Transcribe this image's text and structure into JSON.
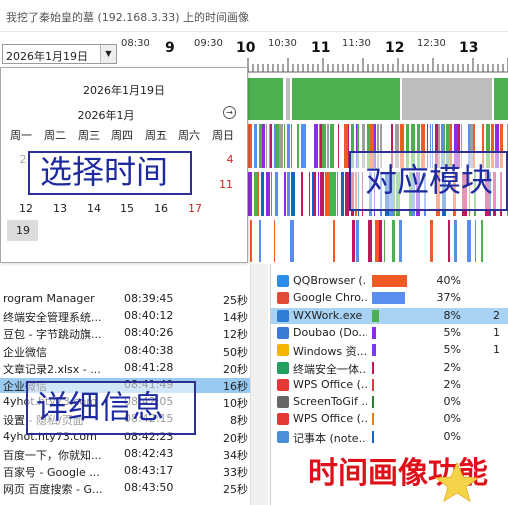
{
  "window": {
    "title": "我挖了秦始皇的墓 (192.168.3.33) 上的时间画像"
  },
  "date_picker": {
    "value": "2026年1月19日",
    "arrow": "▼"
  },
  "timeline": {
    "big_hours": [
      "9",
      "10",
      "11",
      "12",
      "13"
    ],
    "half_hours": [
      "08:30",
      "09:30",
      "10:30",
      "11:30",
      "12:30"
    ]
  },
  "calendar": {
    "today": "2026年1月19日",
    "month": "2026年1月",
    "next": "→",
    "weekdays": [
      "周一",
      "周二",
      "周三",
      "周四",
      "周五",
      "周六",
      "周日"
    ],
    "days_row1": [
      "2",
      "4"
    ],
    "days_row2": [
      "11"
    ],
    "days_row3": [
      "12",
      "13",
      "14",
      "15",
      "16",
      "17"
    ],
    "days_row4": [
      "19"
    ]
  },
  "detail_rows": [
    {
      "name": "rogram Manager",
      "time": "08:39:45",
      "dur": "25秒"
    },
    {
      "name": "终端安全管理系统...",
      "time": "08:40:12",
      "dur": "14秒"
    },
    {
      "name": "豆包 - 字节跳动旗...",
      "time": "08:40:26",
      "dur": "12秒"
    },
    {
      "name": "企业微信",
      "time": "08:40:38",
      "dur": "50秒"
    },
    {
      "name": "文章记录2.xlsx - ...",
      "time": "08:41:28",
      "dur": "20秒"
    },
    {
      "name": "企业微信",
      "time": "08:41:49",
      "dur": "16秒"
    },
    {
      "name": "4yhot.hty73.com",
      "time": "08:42:05",
      "dur": "10秒"
    },
    {
      "name": "设置 - 隐私/页面",
      "time": "08:42:15",
      "dur": "8秒"
    },
    {
      "name": "4yhot.hty73.com",
      "time": "08:42:23",
      "dur": "20秒"
    },
    {
      "name": "百度一下，你就知...",
      "time": "08:42:43",
      "dur": "34秒"
    },
    {
      "name": "百家号 - Google ...",
      "time": "08:43:17",
      "dur": "33秒"
    },
    {
      "name": "网页 百度搜索 - G...",
      "time": "08:43:50",
      "dur": "25秒"
    }
  ],
  "app_rows": [
    {
      "name": "QQBrowser (...",
      "percent": "40%",
      "extra": "",
      "share": 0.4,
      "color": "#f05a24",
      "icon": "qq-browser-icon",
      "icon_color": "#2a8ee8"
    },
    {
      "name": "Google Chro...",
      "percent": "37%",
      "extra": "",
      "share": 0.37,
      "color": "#5b8def",
      "icon": "chrome-icon",
      "icon_color": "#e04b36"
    },
    {
      "name": "WXWork.exe",
      "percent": "8%",
      "extra": "2",
      "share": 0.08,
      "color": "#4caf50",
      "icon": "wxwork-icon",
      "icon_color": "#2f7fd8"
    },
    {
      "name": "Doubao (Do...",
      "percent": "5%",
      "extra": "1",
      "share": 0.05,
      "color": "#8b2be2",
      "icon": "doubao-icon",
      "icon_color": "#3a7bd5"
    },
    {
      "name": "Windows 资...",
      "percent": "5%",
      "extra": "1",
      "share": 0.05,
      "color": "#7c3aed",
      "icon": "windows-explorer-icon",
      "icon_color": "#f4b400"
    },
    {
      "name": "终端安全一体...",
      "percent": "2%",
      "extra": "",
      "share": 0.02,
      "color": "#c2185b",
      "icon": "security-icon",
      "icon_color": "#20a060"
    },
    {
      "name": "WPS Office (...",
      "percent": "2%",
      "extra": "",
      "share": 0.02,
      "color": "#e53935",
      "icon": "wps-icon",
      "icon_color": "#e53935"
    },
    {
      "name": "ScreenToGif ...",
      "percent": "0%",
      "extra": "",
      "share": 0.004,
      "color": "#2e7d32",
      "icon": "screentogif-icon",
      "icon_color": "#666666"
    },
    {
      "name": "WPS Office (...",
      "percent": "0%",
      "extra": "",
      "share": 0.004,
      "color": "#f57c00",
      "icon": "wps-icon",
      "icon_color": "#e53935"
    },
    {
      "name": "记事本 (note...",
      "percent": "0%",
      "extra": "",
      "share": 0.003,
      "color": "#1565c0",
      "icon": "notepad-icon",
      "icon_color": "#4a90d9"
    }
  ],
  "annotations": {
    "select_time": "选择时间",
    "module": "对应模块",
    "detail": "详细信息",
    "feature": "时间画像功能"
  }
}
